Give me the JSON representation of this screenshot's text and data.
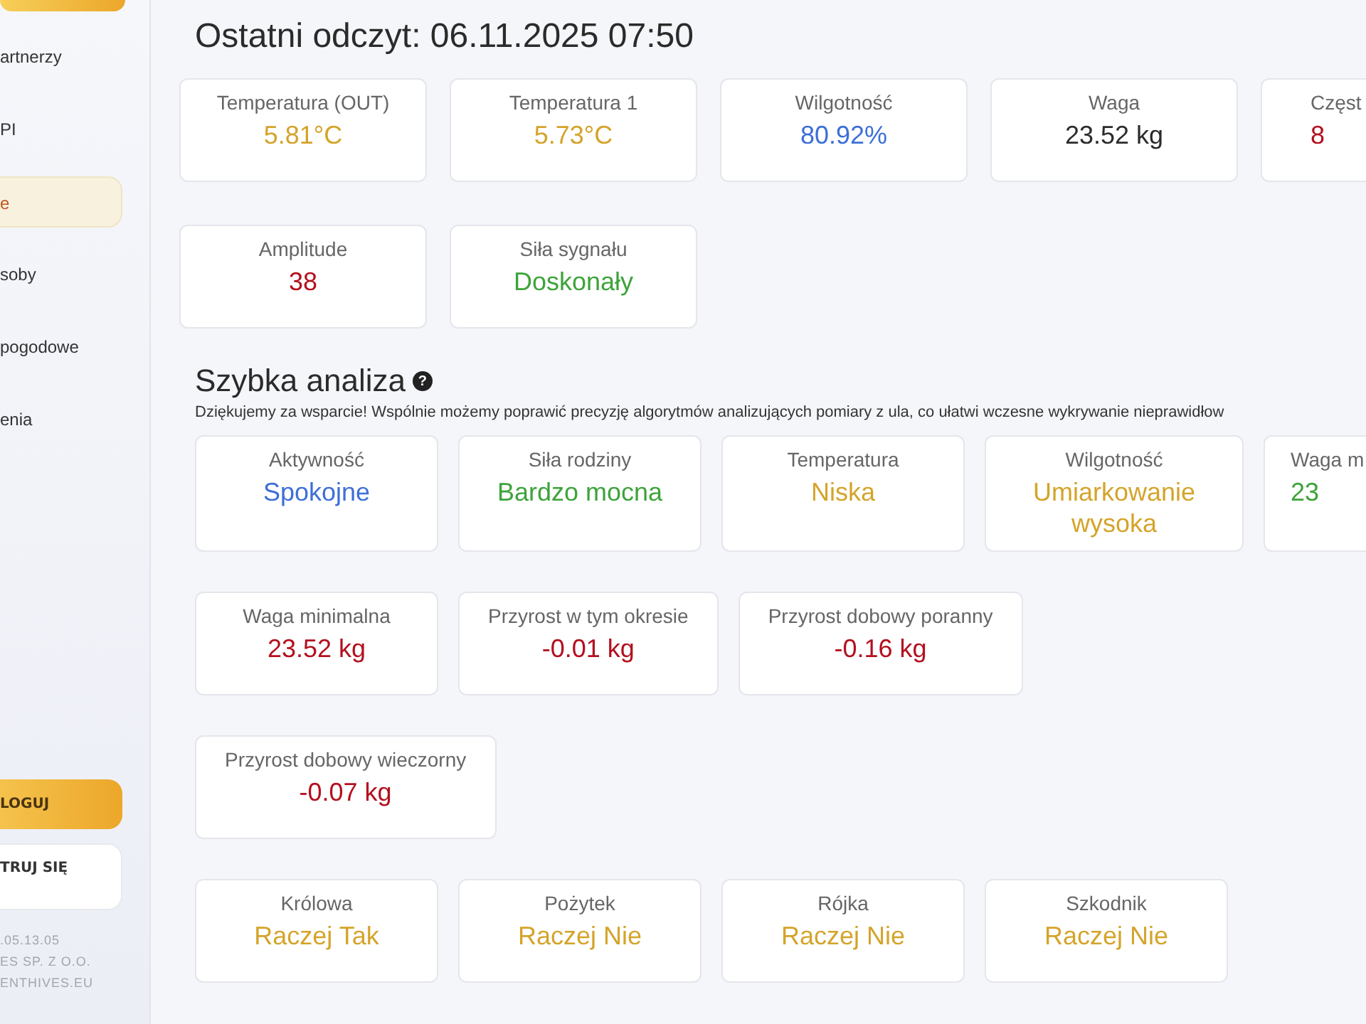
{
  "sidebar": {
    "top_button": {
      "kind": "gold"
    },
    "items": [
      {
        "label": "artnerzy",
        "selected": false
      },
      {
        "label": "PI",
        "selected": false
      },
      {
        "label": "e",
        "selected": true
      },
      {
        "label": "soby",
        "selected": false
      },
      {
        "label": "pogodowe",
        "selected": false
      },
      {
        "label": "enia",
        "selected": false
      }
    ],
    "logout_button": "LOGUJ",
    "register_button": "TRUJ SIĘ",
    "footer": [
      ".05.13.05",
      "ES SP. Z O.O.",
      "ENTHIVES.EU"
    ]
  },
  "last_reading": {
    "title": "Ostatni odczyt: 06.11.2025 07:50",
    "rows": [
      [
        {
          "label": "Temperatura (OUT)",
          "value": "5.81°C",
          "color": "#d4a42a"
        },
        {
          "label": "Temperatura 1",
          "value": "5.73°C",
          "color": "#d4a42a"
        },
        {
          "label": "Wilgotność",
          "value": "80.92%",
          "color": "#3d6fd8"
        },
        {
          "label": "Waga",
          "value": "23.52 kg",
          "color": "#2b2b2b"
        },
        {
          "label": "Częst",
          "value": "8",
          "color": "#b3101e",
          "cut": true
        }
      ],
      [
        {
          "label": "Amplitude",
          "value": "38",
          "color": "#b3101e"
        },
        {
          "label": "Siła sygnału",
          "value": "Doskonały",
          "color": "#3da33a"
        }
      ]
    ]
  },
  "analysis": {
    "title": "Szybka analiza",
    "help_icon": "?",
    "description": "Dziękujemy za wsparcie! Wspólnie możemy poprawić precyzję algorytmów analizujących pomiary z ula, co ułatwi wczesne wykrywanie nieprawidłow",
    "rows": [
      [
        {
          "label": "Aktywność",
          "value": "Spokojne",
          "color": "#3d6fd8"
        },
        {
          "label": "Siła rodziny",
          "value": "Bardzo mocna",
          "color": "#3da33a"
        },
        {
          "label": "Temperatura",
          "value": "Niska",
          "color": "#d4a42a"
        },
        {
          "label": "Wilgotność",
          "value": "Umiarkowanie wysoka",
          "color": "#d4a42a"
        },
        {
          "label": "Waga m",
          "value": "23",
          "color": "#3da33a",
          "cut": true
        }
      ],
      [
        {
          "label": "Waga minimalna",
          "value": "23.52 kg",
          "color": "#b3101e"
        },
        {
          "label": "Przyrost w tym okresie",
          "value": "-0.01 kg",
          "color": "#b3101e"
        },
        {
          "label": "Przyrost dobowy poranny",
          "value": "-0.16 kg",
          "color": "#b3101e"
        }
      ],
      [
        {
          "label": "Przyrost dobowy wieczorny",
          "value": "-0.07 kg",
          "color": "#b3101e"
        }
      ],
      [
        {
          "label": "Królowa",
          "value": "Raczej Tak",
          "color": "#d4a42a"
        },
        {
          "label": "Pożytek",
          "value": "Raczej Nie",
          "color": "#d4a42a"
        },
        {
          "label": "Rójka",
          "value": "Raczej Nie",
          "color": "#d4a42a"
        },
        {
          "label": "Szkodnik",
          "value": "Raczej Nie",
          "color": "#d4a42a"
        }
      ]
    ]
  }
}
